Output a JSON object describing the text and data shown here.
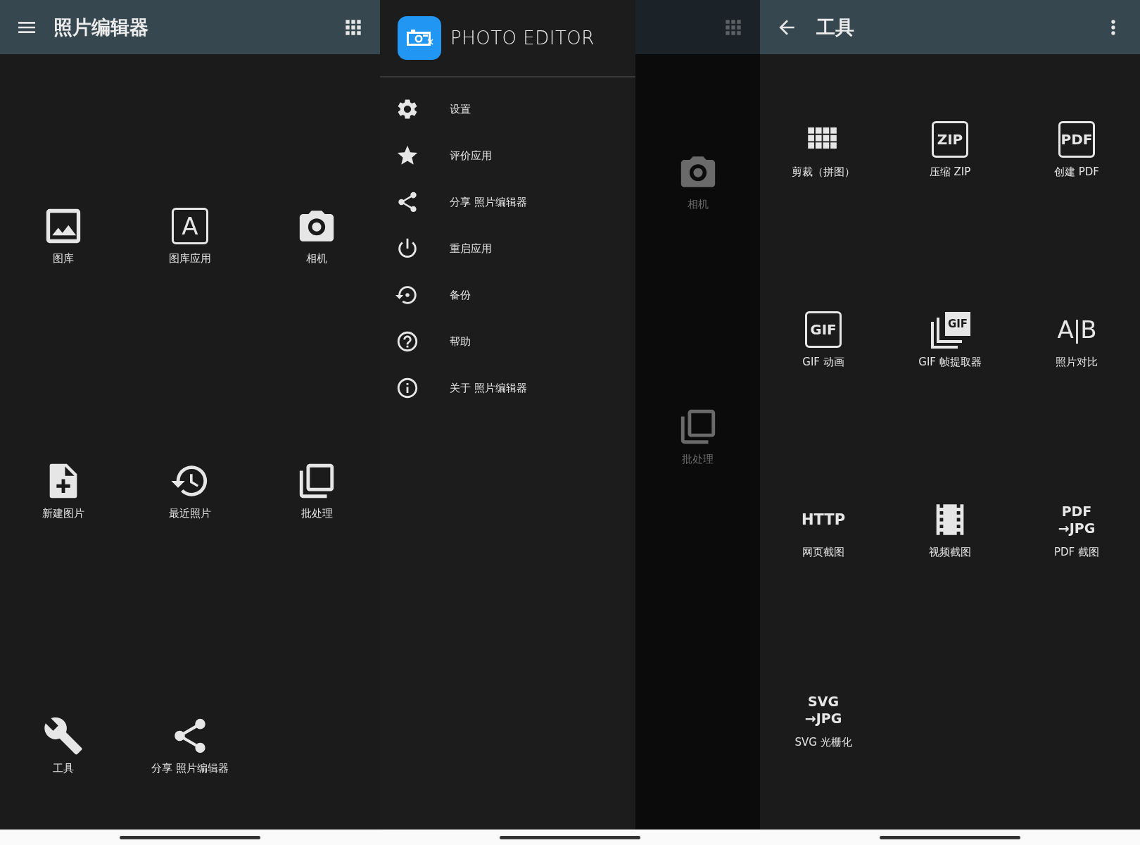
{
  "screens": [
    {
      "kind": "home",
      "toolbar": {
        "title": "照片编辑器"
      },
      "items": [
        {
          "label": "图库"
        },
        {
          "label": "图库应用",
          "icon_text": "A"
        },
        {
          "label": "相机"
        },
        {
          "label": "新建图片"
        },
        {
          "label": "最近照片"
        },
        {
          "label": "批处理"
        },
        {
          "label": "工具"
        },
        {
          "label": "分享 照片编辑器"
        }
      ]
    },
    {
      "kind": "drawer",
      "drawer": {
        "app_name": "PHOTO EDITOR",
        "items": [
          {
            "label": "设置"
          },
          {
            "label": "评价应用"
          },
          {
            "label": "分享 照片编辑器"
          },
          {
            "label": "重启应用"
          },
          {
            "label": "备份"
          },
          {
            "label": "帮助"
          },
          {
            "label": "关于 照片编辑器"
          }
        ]
      },
      "background": {
        "items": [
          {
            "label": "相机"
          },
          {
            "label": "批处理"
          }
        ]
      }
    },
    {
      "kind": "tools",
      "toolbar": {
        "title": "工具"
      },
      "items": [
        {
          "label": "剪裁（拼图）"
        },
        {
          "label": "压缩 ZIP",
          "icon_text": "ZIP"
        },
        {
          "label": "创建 PDF",
          "icon_text": "PDF"
        },
        {
          "label": "GIF 动画",
          "icon_text": "GIF"
        },
        {
          "label": "GIF 帧提取器",
          "icon_text": "GIF"
        },
        {
          "label": "照片对比",
          "icon_text": "A|B"
        },
        {
          "label": "网页截图",
          "icon_text": "HTTP"
        },
        {
          "label": "视频截图"
        },
        {
          "label": "PDF 截图",
          "icon_lines": [
            "PDF",
            "→JPG"
          ]
        },
        {
          "label": "SVG 光栅化",
          "icon_lines": [
            "SVG",
            "→JPG"
          ]
        }
      ]
    }
  ]
}
